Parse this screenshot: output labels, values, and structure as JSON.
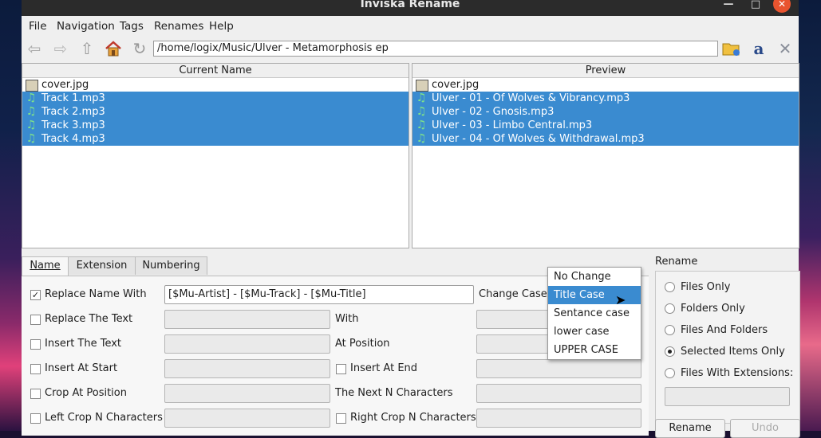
{
  "window": {
    "title": "Inviska Rename"
  },
  "menu": [
    "File",
    "Navigation",
    "Tags",
    "Renames",
    "Help"
  ],
  "toolbar": {
    "path": "/home/logix/Music/Ulver - Metamorphosis ep"
  },
  "current": {
    "header": "Current Name",
    "rows": [
      {
        "name": "cover.jpg",
        "icon": "image-icon",
        "selected": false
      },
      {
        "name": "Track 1.mp3",
        "icon": "music-note-icon",
        "selected": true
      },
      {
        "name": "Track 2.mp3",
        "icon": "music-note-icon",
        "selected": true
      },
      {
        "name": "Track 3.mp3",
        "icon": "music-note-icon",
        "selected": true
      },
      {
        "name": "Track 4.mp3",
        "icon": "music-note-icon",
        "selected": true
      }
    ]
  },
  "preview": {
    "header": "Preview",
    "rows": [
      {
        "name": "cover.jpg",
        "icon": "image-icon",
        "selected": false
      },
      {
        "name": "Ulver - 01 - Of Wolves & Vibrancy.mp3",
        "icon": "music-note-icon",
        "selected": true
      },
      {
        "name": "Ulver - 02 - Gnosis.mp3",
        "icon": "music-note-icon",
        "selected": true
      },
      {
        "name": "Ulver - 03 - Limbo Central.mp3",
        "icon": "music-note-icon",
        "selected": true
      },
      {
        "name": "Ulver - 04 - Of Wolves & Withdrawal.mp3",
        "icon": "music-note-icon",
        "selected": true
      }
    ]
  },
  "tabs": [
    "Name",
    "Extension",
    "Numbering"
  ],
  "name_tab": {
    "replace_name_with": "Replace Name With",
    "replace_name_value": "[$Mu-Artist] - [$Mu-Track] - [$Mu-Title]",
    "change_case": "Change Case",
    "replace_the_text": "Replace The Text",
    "with": "With",
    "insert_the_text": "Insert The Text",
    "at_position": "At Position",
    "insert_at_start": "Insert At Start",
    "insert_at_end": "Insert At End",
    "crop_at_position": "Crop At Position",
    "next_n_chars": "The Next N Characters",
    "left_crop": "Left Crop N Characters",
    "right_crop": "Right Crop N Characters"
  },
  "case_options": [
    "No Change",
    "Title Case",
    "Sentance case",
    "lower case",
    "UPPER CASE"
  ],
  "case_highlighted": "Title Case",
  "rename_group": {
    "title": "Rename",
    "options": [
      "Files Only",
      "Folders Only",
      "Files And Folders",
      "Selected Items Only",
      "Files With Extensions:"
    ],
    "selected": "Selected Items Only",
    "rename_button": "Rename",
    "undo_button": "Undo"
  }
}
